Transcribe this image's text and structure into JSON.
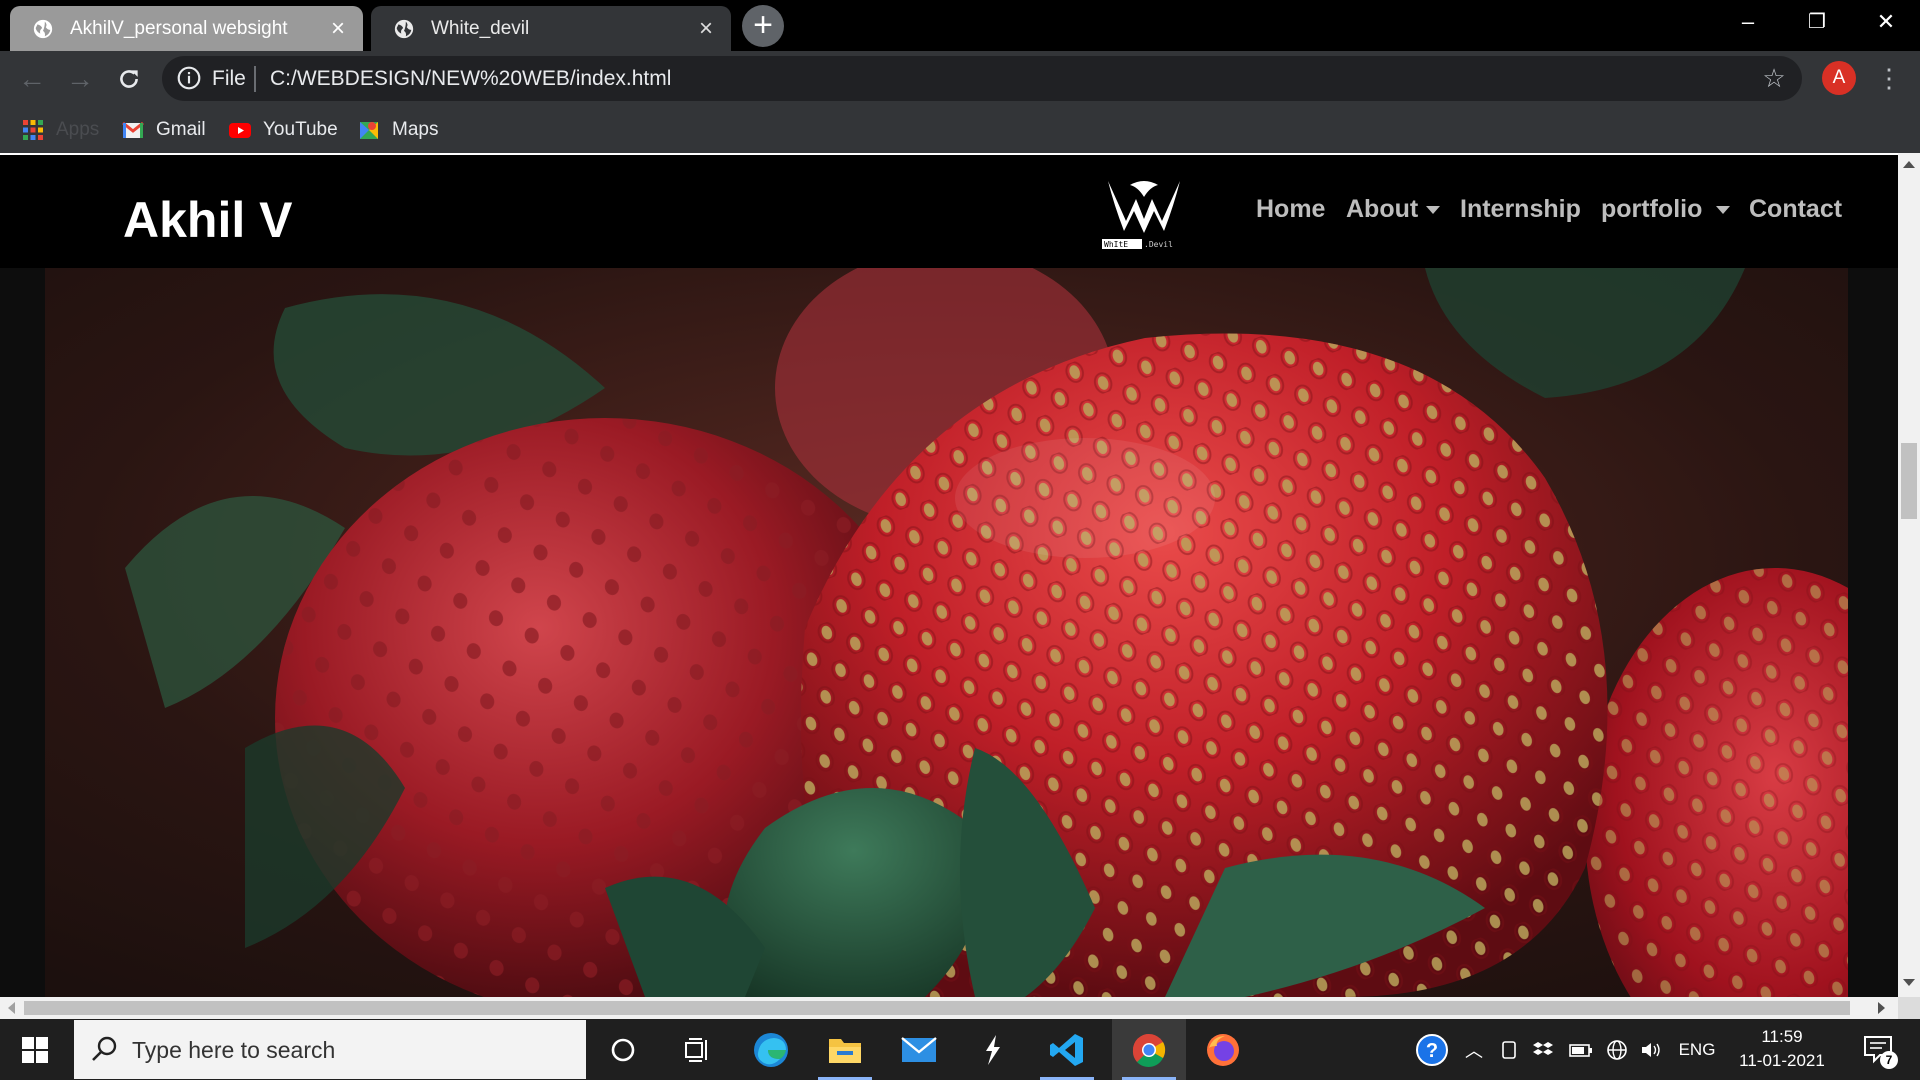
{
  "browser": {
    "tabs": [
      {
        "title": "AkhilV_personal websight",
        "active": false
      },
      {
        "title": "White_devil",
        "active": true
      }
    ],
    "new_tab_icon": "plus-icon",
    "window_controls": {
      "minimize": "–",
      "restore": "❐",
      "close": "✕"
    },
    "address_bar": {
      "scheme_label": "File",
      "url": "C:/WEBDESIGN/NEW%20WEB/index.html"
    },
    "profile_initial": "A",
    "bookmarks": [
      {
        "label": "Apps",
        "icon": "apps-grid-icon"
      },
      {
        "label": "Gmail",
        "icon": "gmail-icon"
      },
      {
        "label": "YouTube",
        "icon": "youtube-icon"
      },
      {
        "label": "Maps",
        "icon": "maps-icon"
      }
    ]
  },
  "site": {
    "brand": "Akhil V",
    "logo_text": "WhItE Devil",
    "nav": [
      {
        "label": "Home",
        "dropdown": false
      },
      {
        "label": "About",
        "dropdown": true
      },
      {
        "label": "Internship",
        "dropdown": false
      },
      {
        "label": "portfolio",
        "dropdown": true
      },
      {
        "label": "Contact",
        "dropdown": false
      }
    ],
    "hero_image": "strawberries-closeup"
  },
  "taskbar": {
    "search_placeholder": "Type here to search",
    "apps": [
      "cortana-icon",
      "task-view-icon",
      "edge-icon",
      "file-explorer-icon",
      "mail-icon",
      "app-bolt-icon",
      "vscode-icon",
      "chrome-icon",
      "firefox-icon"
    ],
    "tray": {
      "language": "ENG",
      "time": "11:59",
      "date": "11-01-2021",
      "notification_count": "7"
    }
  },
  "colors": {
    "tab_active": "#333538",
    "tab_inactive": "#9a9a9a",
    "site_header_bg": "#000000",
    "nav_text": "#bdbdbd",
    "profile_avatar": "#d93025"
  }
}
